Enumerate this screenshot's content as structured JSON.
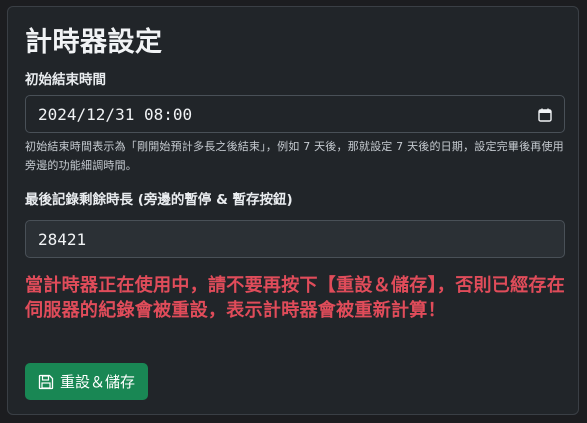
{
  "title": "計時器設定",
  "end_time": {
    "label": "初始結束時間",
    "value": "2024/12/31 08:00",
    "icon": "calendar-icon",
    "help": "初始結束時間表示為「剛開始預計多長之後結束」，例如 7 天後，那就設定 7 天後的日期，設定完畢後再使用旁邊的功能細調時間。"
  },
  "remaining": {
    "label": "最後記錄剩餘時長 (旁邊的暫停 & 暫存按鈕)",
    "value": "28421"
  },
  "warning": "當計時器正在使用中，請不要再按下【重設＆儲存】，否則已經存在伺服器的紀錄會被重設，表示計時器會被重新計算！",
  "reset_button": {
    "label": "重設＆儲存",
    "icon": "floppy-disk-icon"
  },
  "colors": {
    "background": "#212529",
    "warning": "#e04c5a",
    "button": "#198754"
  }
}
